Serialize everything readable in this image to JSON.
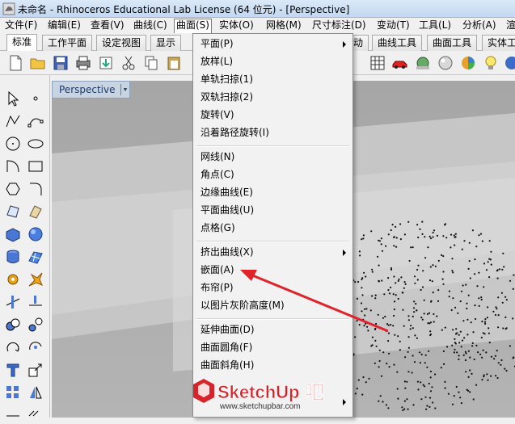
{
  "window": {
    "title": "未命名 - Rhinoceros Educational Lab License (64 位元) - [Perspective]"
  },
  "menubar": {
    "items": [
      "文件(F)",
      "编辑(E)",
      "查看(V)",
      "曲线(C)",
      "曲面(S)",
      "实体(O)",
      "网格(M)",
      "尺寸标注(D)",
      "变动(T)",
      "工具(L)",
      "分析(A)",
      "渲"
    ],
    "active": "曲面(S)"
  },
  "tabs": {
    "items": [
      "标准",
      "工作平面",
      "设定视图",
      "显示",
      "动",
      "曲线工具",
      "曲面工具",
      "实体工"
    ],
    "selected": "标准"
  },
  "viewport": {
    "label": "Perspective"
  },
  "surface_menu": {
    "items": [
      {
        "label": "平面(P)",
        "submenu": true
      },
      {
        "label": "放样(L)"
      },
      {
        "label": "单轨扫掠(1)"
      },
      {
        "label": "双轨扫掠(2)"
      },
      {
        "label": "旋转(V)"
      },
      {
        "label": "沿着路径旋转(I)"
      },
      {
        "label": "网线(N)"
      },
      {
        "label": "角点(C)"
      },
      {
        "label": "边缘曲线(E)"
      },
      {
        "label": "平面曲线(U)"
      },
      {
        "label": "点格(G)"
      },
      {
        "label": "挤出曲线(X)",
        "submenu": true
      },
      {
        "label": "嵌面(A)"
      },
      {
        "label": "布帘(P)"
      },
      {
        "label": "以图片灰阶高度(M)"
      },
      {
        "label": "延伸曲面(D)"
      },
      {
        "label": "曲面圆角(F)"
      },
      {
        "label": "曲面斜角(H)"
      },
      {
        "label": "",
        "submenu": true
      }
    ]
  },
  "watermark": {
    "brand_main": "SketchUp",
    "brand_suffix": "吧",
    "url": "www.sketchupbar.com"
  },
  "colors": {
    "annotation_arrow": "#e0222a",
    "logo_red": "#d9232b",
    "menu_highlight": "#ffffff"
  }
}
